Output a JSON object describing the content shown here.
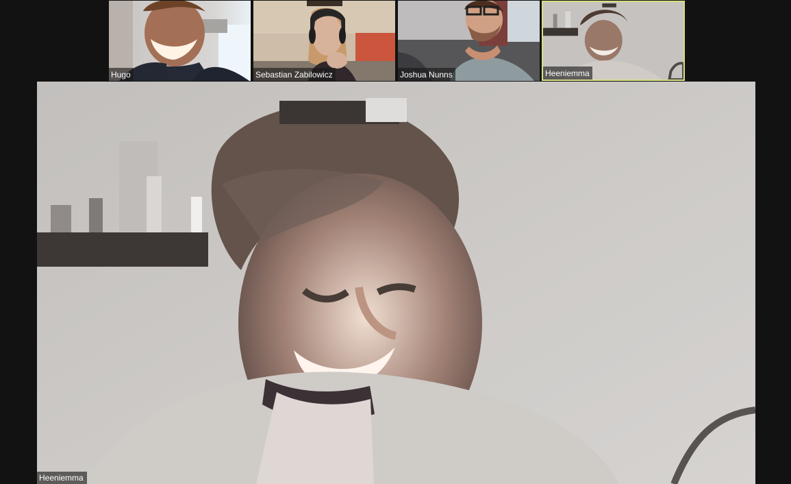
{
  "meeting": {
    "participants": [
      {
        "name": "Hugo",
        "avatar_icon": "participant-video-feed"
      },
      {
        "name": "Sebastian Zabilowicz",
        "avatar_icon": "participant-video-feed"
      },
      {
        "name": "Joshua Nunns",
        "avatar_icon": "participant-video-feed"
      },
      {
        "name": "Heeniemma",
        "avatar_icon": "participant-video-feed"
      }
    ],
    "active_speaker": {
      "name": "Heeniemma"
    }
  },
  "colors": {
    "background": "#121212",
    "active_speaker_border": "#d7e07f",
    "name_tag_background": "#181818",
    "name_tag_text": "#ffffff"
  }
}
